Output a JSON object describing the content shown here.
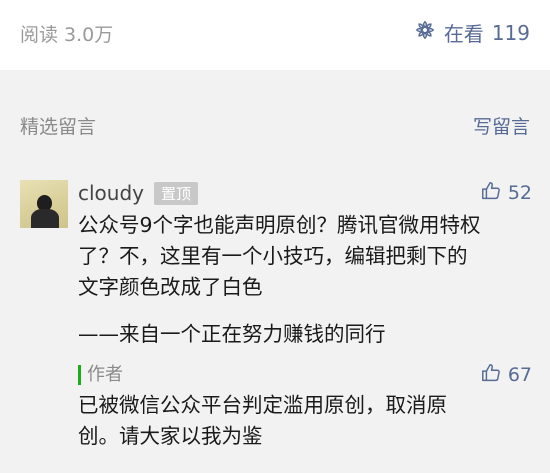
{
  "stats": {
    "reads": "阅读 3.0万",
    "watching_label": "在看",
    "watching_count": "119",
    "watching_icon": "flower-icon"
  },
  "comments_section": {
    "title": "精选留言",
    "write_label": "写留言"
  },
  "comment": {
    "nickname": "cloudy",
    "badge": "置顶",
    "like_icon": "thumbs-up-icon",
    "likes": "52",
    "text": "公众号9个字也能声明原创？腾讯官微用特权\n了？不，这里有一个小技巧，编辑把剩下的\n文字颜色改成了白色",
    "sign": "——来自一个正在努力赚钱的同行"
  },
  "reply": {
    "tag": "作者",
    "likes": "67",
    "text": "已被微信公众平台判定滥用原创，取消原\n创。请大家以我为鉴"
  },
  "colors": {
    "link": "#576b95",
    "author_bar": "#1aad19",
    "muted": "#9a9a9a",
    "section_bg": "#f2f2f2"
  }
}
